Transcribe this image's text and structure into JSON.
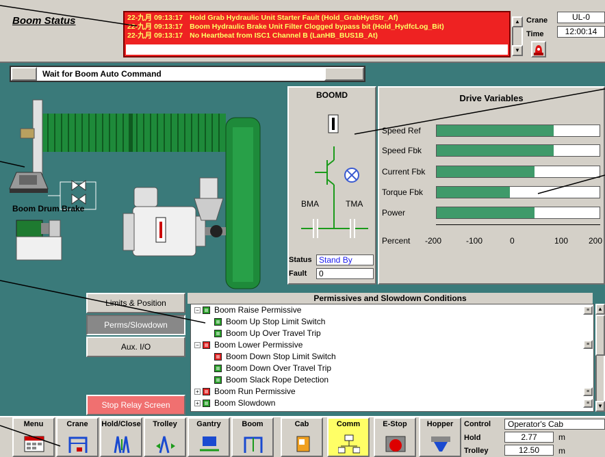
{
  "header": {
    "title": "Boom Status",
    "crane_label": "Crane",
    "crane_value": "UL-0",
    "time_label": "Time",
    "time_value": "12:00:14"
  },
  "alarms": [
    {
      "time": "22-九月 09:13:17",
      "text": "Hold Grab Hydraulic Unit Starter Fault (Hold_GrabHydStr_Af)"
    },
    {
      "time": "22-九月 09:13:17",
      "text": "Boom Hydraulic Brake Unit Filter Clogged bypass bit (Hold_HydfcLog_Bit)"
    },
    {
      "time": "22-九月 09:13:17",
      "text": "No Heartbeat from ISC1 Channel B  (LanHB_BUS1B_At)"
    }
  ],
  "status_bar": {
    "message": "Wait for Boom Auto Command"
  },
  "machine": {
    "brake_label": "Boom Drum Brake"
  },
  "boomd": {
    "title": "BOOMD",
    "bma": "BMA",
    "tma": "TMA",
    "status_label": "Status",
    "status_value": "Stand By",
    "fault_label": "Fault",
    "fault_value": "0"
  },
  "drive": {
    "title": "Drive Variables",
    "percent_label": "Percent",
    "axis": [
      "-200",
      "-100",
      "0",
      "100",
      "200"
    ],
    "items": [
      {
        "label": "Speed Ref",
        "percent": 72
      },
      {
        "label": "Speed Fbk",
        "percent": 72
      },
      {
        "label": "Current Fbk",
        "percent": 60
      },
      {
        "label": "Torque Fbk",
        "percent": 45
      },
      {
        "label": "Power",
        "percent": 60
      }
    ]
  },
  "side_buttons": {
    "limits": "Limits & Position",
    "perms": "Perms/Slowdown",
    "aux": "Aux. I/O",
    "stop": "Stop Relay Screen"
  },
  "permissives": {
    "title": "Permissives and Slowdown Conditions",
    "rows": [
      {
        "text": "Boom Raise Permissive",
        "status": "g",
        "level": 0,
        "expand": "⊟"
      },
      {
        "text": "Boom Up Stop Limit Switch",
        "status": "g",
        "level": 1
      },
      {
        "text": "Boom Up Over Travel Trip",
        "status": "g",
        "level": 1
      },
      {
        "text": "Boom Lower Permissive",
        "status": "r",
        "level": 0,
        "expand": "⊟"
      },
      {
        "text": "Boom Down Stop Limit Switch",
        "status": "r",
        "level": 1
      },
      {
        "text": "Boom Down Over Travel Trip",
        "status": "g",
        "level": 1
      },
      {
        "text": "Boom Slack Rope Detection",
        "status": "g",
        "level": 1
      },
      {
        "text": "Boom Run Permissive",
        "status": "r",
        "level": 0,
        "expand": "⊞"
      },
      {
        "text": "Boom Slowdown",
        "status": "g",
        "level": 0,
        "expand": "⊞"
      }
    ]
  },
  "nav": {
    "items": [
      "Menu",
      "Crane",
      "Hold/Close",
      "Trolley",
      "Gantry",
      "Boom",
      "Cab",
      "Comm",
      "E-Stop",
      "Hopper"
    ],
    "control_label": "Control",
    "control_value": "Operator's Cab",
    "hold_label": "Hold",
    "hold_value": "2.77",
    "hold_unit": "m",
    "trolley_label": "Trolley",
    "trolley_value": "12.50",
    "trolley_unit": "m"
  }
}
